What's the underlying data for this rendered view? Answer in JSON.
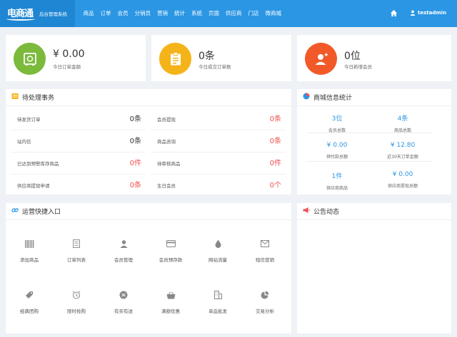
{
  "brand": {
    "logo": "电商通",
    "subtitle": "后台管理系统"
  },
  "nav": [
    "商品",
    "订单",
    "会员",
    "分销员",
    "营销",
    "统计",
    "系统",
    "页面",
    "供应商",
    "门店",
    "微商城"
  ],
  "user": {
    "name": "testadmin"
  },
  "stats": [
    {
      "value": "¥ 0.00",
      "label": "今日订单金额",
      "color": "#7cba3c",
      "icon": "safe-icon"
    },
    {
      "value": "0条",
      "label": "今日成交订单数",
      "color": "#f5b31a",
      "icon": "clipboard-icon"
    },
    {
      "value": "0位",
      "label": "今日新增会员",
      "color": "#f15a28",
      "icon": "user-add-icon"
    }
  ],
  "todo": {
    "title": "待处理事务",
    "items": [
      {
        "label": "待发货订单",
        "value": "0条",
        "red": false
      },
      {
        "label": "会员提现",
        "value": "0条",
        "red": true
      },
      {
        "label": "站内信",
        "value": "0条",
        "red": false
      },
      {
        "label": "商品咨询",
        "value": "0条",
        "red": true
      },
      {
        "label": "已达到预警库存商品",
        "value": "0件",
        "red": true
      },
      {
        "label": "待审核商品",
        "value": "0件",
        "red": true
      },
      {
        "label": "供应商提现申请",
        "value": "0条",
        "red": true
      },
      {
        "label": "生日会员",
        "value": "0个",
        "red": true
      }
    ]
  },
  "mall_stats": {
    "title": "商城信息统计",
    "items": [
      {
        "value": "3位",
        "label": "会员总数"
      },
      {
        "value": "4条",
        "label": "商品总数"
      },
      {
        "value": "¥ 0.00",
        "label": "预付款总额"
      },
      {
        "value": "¥ 12.80",
        "label": "近30天订单金额"
      },
      {
        "value": "1件",
        "label": "供应商商品"
      },
      {
        "value": "¥ 0.00",
        "label": "供应商提现总额"
      }
    ]
  },
  "quick": {
    "title": "运营快捷入口",
    "items": [
      {
        "label": "添加商品",
        "icon": "barcode-icon"
      },
      {
        "label": "订单列表",
        "icon": "document-icon"
      },
      {
        "label": "会员管理",
        "icon": "person-icon"
      },
      {
        "label": "会员预存款",
        "icon": "card-icon"
      },
      {
        "label": "网站流量",
        "icon": "droplet-icon"
      },
      {
        "label": "短信营销",
        "icon": "envelope-icon"
      },
      {
        "label": "经典团购",
        "icon": "tag-icon"
      },
      {
        "label": "限时抢购",
        "icon": "alarm-icon"
      },
      {
        "label": "有买有送",
        "icon": "gift-icon"
      },
      {
        "label": "满额优惠",
        "icon": "basket-icon"
      },
      {
        "label": "单品批发",
        "icon": "building-icon"
      },
      {
        "label": "交易分析",
        "icon": "pie-icon"
      }
    ]
  },
  "notice": {
    "title": "公告动态"
  },
  "colors": {
    "primary": "#2a96e4",
    "red": "#f05050"
  }
}
